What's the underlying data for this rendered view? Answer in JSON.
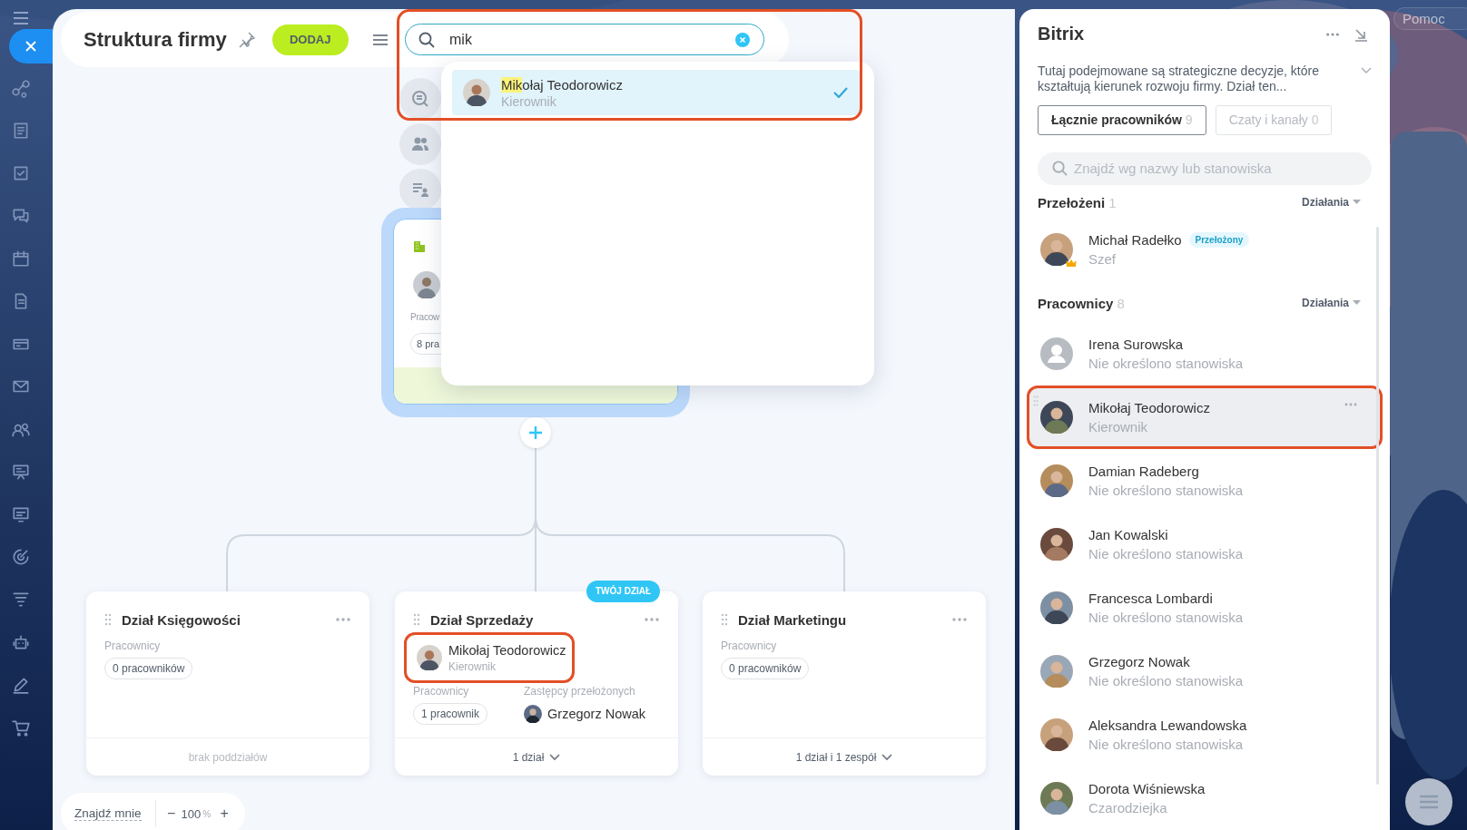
{
  "header": {
    "title": "Struktura firmy",
    "add_button": "DODAJ",
    "search": {
      "value": "mik",
      "annotated": true
    }
  },
  "search_results": [
    {
      "name_match": "Mik",
      "name_rest": "ołaj Teodorowicz",
      "position": "Kierownik",
      "selected": true
    }
  ],
  "root_card": {
    "employees_label": "Pracow",
    "employees_count": "8 pra"
  },
  "departments": [
    {
      "title": "Dział Księgowości",
      "employees_label": "Pracownicy",
      "employees_count": "0 pracowników",
      "footer": "brak poddziałów",
      "expandable": false
    },
    {
      "title": "Dział Sprzedaży",
      "badge": "TWÓJ DZIAŁ",
      "head": {
        "name": "Mikołaj Teodorowicz",
        "position": "Kierownik",
        "annotated": true
      },
      "employees_label": "Pracownicy",
      "employees_count": "1 pracownik",
      "deputies_label": "Zastępcy przełożonych",
      "deputy": "Grzegorz Nowak",
      "footer": "1 dział",
      "expandable": true
    },
    {
      "title": "Dział Marketingu",
      "employees_label": "Pracownicy",
      "employees_count": "0 pracowników",
      "footer": "1 dział i 1 zespół",
      "expandable": true
    }
  ],
  "zoom": {
    "find_me": "Znajdź mnie",
    "minus": "−",
    "value": "100",
    "unit": "%",
    "plus": "+"
  },
  "panel": {
    "title": "Bitrix",
    "description": "Tutaj podejmowane są strategiczne decyzje, które kształtują kierunek rozwoju firmy. Dział ten...",
    "tabs": [
      {
        "label": "Łącznie pracowników",
        "count": "9",
        "selected": true
      },
      {
        "label": "Czaty i kanały",
        "count": "0",
        "selected": false
      }
    ],
    "search_placeholder": "Znajdź wg nazwy lub stanowiska",
    "sections": [
      {
        "title": "Przełożeni",
        "count": "1",
        "actions": "Działania",
        "people": [
          {
            "name": "Michał Radełko",
            "badge": "Przełożony",
            "position": "Szef",
            "crown": true,
            "hovered": false,
            "annotated": false
          }
        ]
      },
      {
        "title": "Pracownicy",
        "count": "8",
        "actions": "Działania",
        "people": [
          {
            "name": "Irena Surowska",
            "position": "Nie określono stanowiska",
            "kind": "placeholder",
            "crown": false,
            "hovered": false,
            "annotated": false
          },
          {
            "name": "Mikołaj Teodorowicz",
            "position": "Kierownik",
            "crown": false,
            "hovered": true,
            "annotated": true
          },
          {
            "name": "Damian Radeberg",
            "position": "Nie określono stanowiska",
            "crown": false,
            "hovered": false,
            "annotated": false
          },
          {
            "name": "Jan Kowalski",
            "position": "Nie określono stanowiska",
            "crown": false,
            "hovered": false,
            "annotated": false
          },
          {
            "name": "Francesca Lombardi",
            "position": "Nie określono stanowiska",
            "crown": false,
            "hovered": false,
            "annotated": false
          },
          {
            "name": "Grzegorz Nowak",
            "position": "Nie określono stanowiska",
            "crown": false,
            "hovered": false,
            "annotated": false
          },
          {
            "name": "Aleksandra Lewandowska",
            "position": "Nie określono stanowiska",
            "crown": false,
            "hovered": false,
            "annotated": false
          },
          {
            "name": "Dorota Wiśniewska",
            "position": "Czarodziejka",
            "crown": false,
            "hovered": false,
            "annotated": false
          }
        ]
      }
    ]
  },
  "help_button": "Pomoc"
}
